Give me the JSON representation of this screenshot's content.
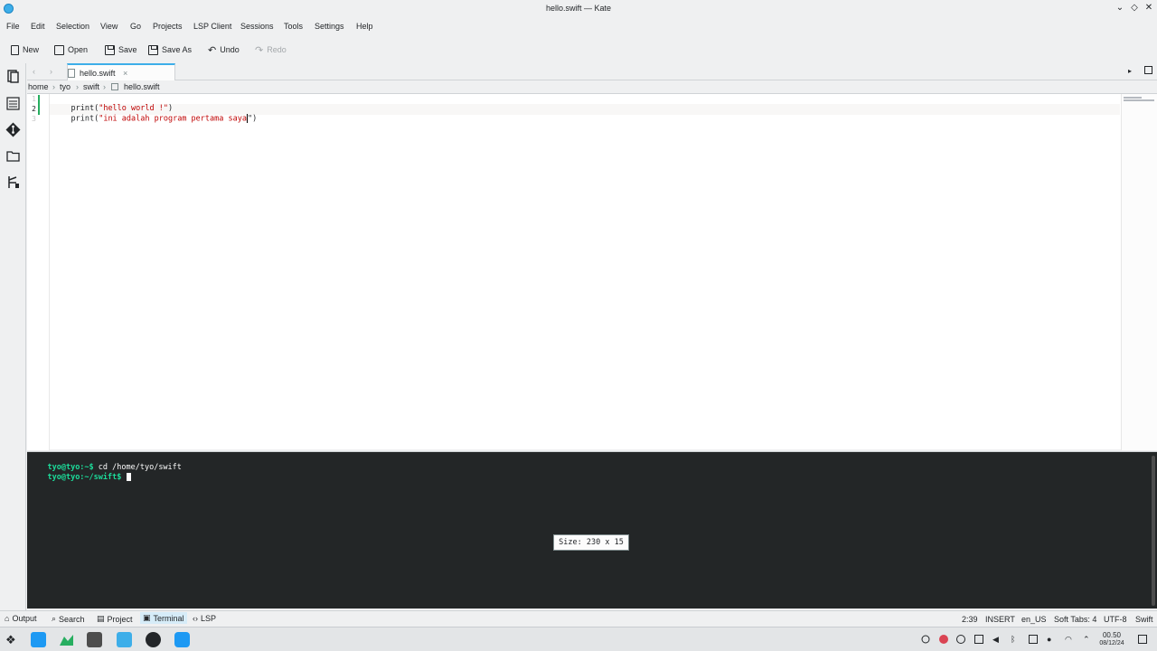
{
  "window": {
    "title": "hello.swift — Kate"
  },
  "menu": [
    "File",
    "Edit",
    "Selection",
    "View",
    "Go",
    "Projects",
    "LSP Client",
    "Sessions",
    "Tools",
    "Settings",
    "Help"
  ],
  "toolbar": {
    "new": "New",
    "open": "Open",
    "save": "Save",
    "save_as": "Save As",
    "undo": "Undo",
    "redo": "Redo"
  },
  "tab": {
    "label": "hello.swift",
    "close": "×"
  },
  "breadcrumb": [
    "home",
    "tyo",
    "swift",
    "hello.swift"
  ],
  "editor": {
    "lines": [
      {
        "num": "1",
        "fn": "print(",
        "str": "\"hello world !\"",
        "end": ")"
      },
      {
        "num": "2",
        "fn": "print(",
        "str": "\"ini adalah program pertama saya",
        "end": "\")"
      },
      {
        "num": "3",
        "fn": "",
        "str": "",
        "end": ""
      }
    ]
  },
  "terminal": {
    "lines": [
      {
        "prompt": "tyo@tyo:~$",
        "cmd": " cd /home/tyo/swift"
      },
      {
        "prompt": "tyo@tyo:~/swift$",
        "cmd": " "
      }
    ],
    "size_tooltip": "Size: 230 x 15"
  },
  "panels": [
    "Output",
    "Search",
    "Project",
    "Terminal",
    "LSP"
  ],
  "status": {
    "position": "2:39",
    "mode": "INSERT",
    "dictionary": "en_US",
    "indent": "Soft Tabs: 4",
    "encoding": "UTF-8",
    "language": "Swift"
  },
  "clock": {
    "time": "00.50",
    "date": "08/12/24"
  },
  "colors": {
    "accent": "#3daee9",
    "terminal_bg": "#232627",
    "prompt": "#1cdc9a",
    "string": "#bf0303"
  }
}
